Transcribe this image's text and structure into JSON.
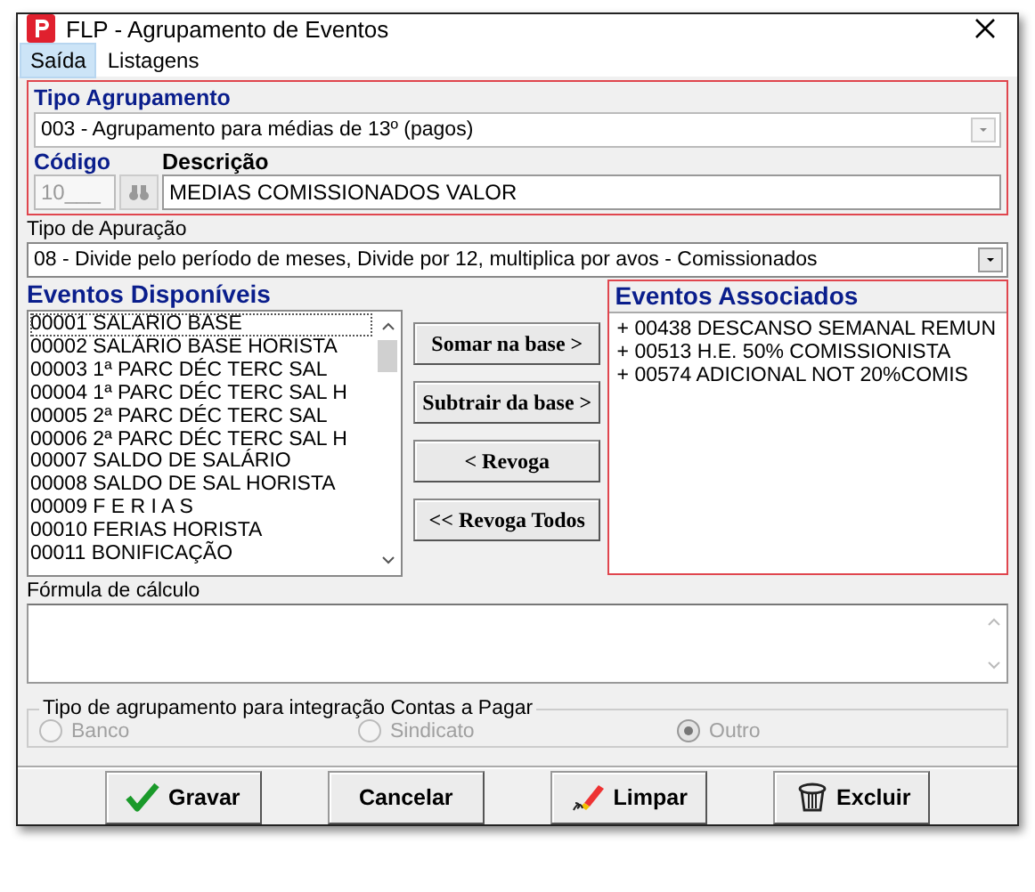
{
  "window": {
    "title": "FLP - Agrupamento de Eventos"
  },
  "menu": [
    {
      "label": "Saída",
      "selected": true
    },
    {
      "label": "Listagens",
      "selected": false
    }
  ],
  "tipo_agrupamento": {
    "label": "Tipo Agrupamento",
    "value": "003 - Agrupamento para médias de 13º (pagos)",
    "disabled": true
  },
  "codigo": {
    "label": "Código",
    "value": "10___",
    "disabled": true
  },
  "descricao": {
    "label": "Descrição",
    "value": "MEDIAS COMISSIONADOS VALOR"
  },
  "tipo_apuracao": {
    "label": "Tipo de Apuração",
    "value": "08 - Divide pelo período de meses, Divide por 12, multiplica por avos - Comissionados"
  },
  "disponiveis": {
    "title": "Eventos Disponíveis",
    "items": [
      {
        "label": "00001 SALARIO BASE",
        "selected": true
      },
      {
        "label": "00002 SALÁRIO BASE HORISTA",
        "selected": false
      },
      {
        "label": "00003 1ª PARC DÉC TERC SAL",
        "selected": false
      },
      {
        "label": "00004 1ª PARC DÉC TERC SAL H",
        "selected": false
      },
      {
        "label": "00005 2ª PARC DÉC TERC SAL",
        "selected": false
      },
      {
        "label": "00006 2ª PARC DÉC TERC SAL H",
        "selected": false
      },
      {
        "label": "00007 SALDO DE SALÁRIO",
        "selected": false
      },
      {
        "label": "00008 SALDO DE SAL HORISTA",
        "selected": false
      },
      {
        "label": "00009 F E R I A S",
        "selected": false
      },
      {
        "label": "00010 FERIAS HORISTA",
        "selected": false
      },
      {
        "label": "00011 BONIFICAÇÃO",
        "selected": false
      }
    ]
  },
  "acoes": [
    "Somar  na base >",
    "Subtrair da base >",
    "< Revoga",
    "<< Revoga Todos"
  ],
  "associados": {
    "title": "Eventos Associados",
    "items": [
      "+ 00438 DESCANSO SEMANAL REMUN",
      "+ 00513 H.E. 50% COMISSIONISTA",
      "+ 00574 ADICIONAL NOT 20%COMIS"
    ]
  },
  "formula": {
    "label": "Fórmula de cálculo"
  },
  "integracao": {
    "label": "Tipo de agrupamento para integração Contas a Pagar",
    "disabled": true,
    "options": [
      {
        "label": "Banco",
        "selected": false
      },
      {
        "label": "Sindicato",
        "selected": false
      },
      {
        "label": "Outro",
        "selected": true
      }
    ]
  },
  "buttons": [
    {
      "label": "Gravar",
      "kind": "check"
    },
    {
      "label": "Cancelar",
      "kind": "plain"
    },
    {
      "label": "Limpar",
      "kind": "eraser"
    },
    {
      "label": "Excluir",
      "kind": "trash"
    }
  ]
}
